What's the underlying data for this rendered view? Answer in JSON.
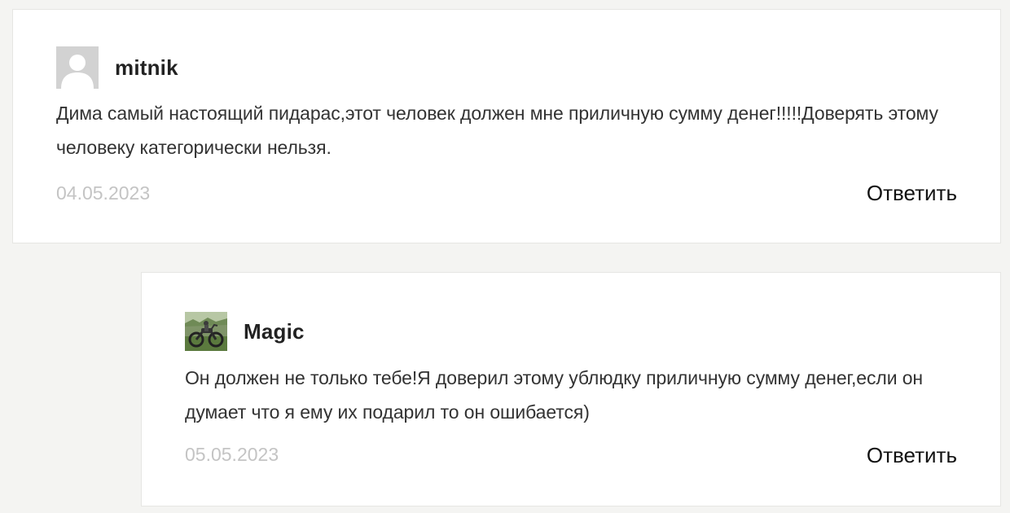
{
  "comments": [
    {
      "author": "mitnik",
      "avatar_icon": "default-user-avatar-icon",
      "text": "Дима самый настоящий пидарас,этот человек должен мне приличную сумму денег!!!!!Доверять этому человеку категорически нельзя.",
      "date": "04.05.2023",
      "reply_label": "Ответить"
    },
    {
      "author": "Magic",
      "avatar_icon": "motorcycle-photo-avatar",
      "text": "Он должен не только тебе!Я доверил этому ублюдку приличную сумму денег,если он думает что я ему их подарил то он ошибается)",
      "date": "05.05.2023",
      "reply_label": "Ответить"
    }
  ],
  "colors": {
    "page_background": "#f4f4f2",
    "card_background": "#ffffff",
    "date_text": "#c4c4c4",
    "body_text": "#333333"
  }
}
